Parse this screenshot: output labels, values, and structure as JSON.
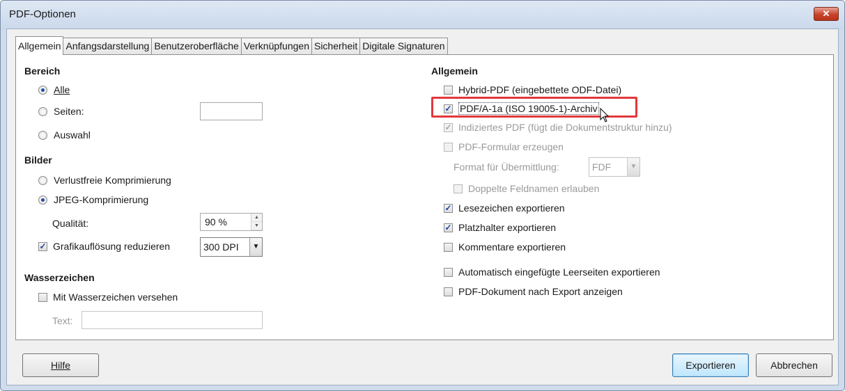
{
  "window": {
    "title": "PDF-Optionen",
    "close_glyph": "✕"
  },
  "tabs": [
    {
      "label": "Allgemein",
      "active": true
    },
    {
      "label": "Anfangsdarstellung"
    },
    {
      "label": "Benutzeroberfläche"
    },
    {
      "label": "Verknüpfungen"
    },
    {
      "label": "Sicherheit"
    },
    {
      "label": "Digitale Signaturen"
    }
  ],
  "left": {
    "bereich": {
      "heading": "Bereich",
      "alle": "Alle",
      "seiten": "Seiten:",
      "seiten_value": "",
      "auswahl": "Auswahl",
      "selected": "Alle"
    },
    "bilder": {
      "heading": "Bilder",
      "verlustfrei": "Verlustfreie Komprimierung",
      "jpeg": "JPEG-Komprimierung",
      "selected": "JPEG-Komprimierung",
      "qualitaet_label": "Qualität:",
      "qualitaet_value": "90 %",
      "reduce_label": "Grafikauflösung reduzieren",
      "reduce_checked": true,
      "dpi_value": "300 DPI"
    },
    "wasserzeichen": {
      "heading": "Wasserzeichen",
      "check_label": "Mit Wasserzeichen versehen",
      "checked": false,
      "text_label": "Text:",
      "text_value": ""
    }
  },
  "right": {
    "heading": "Allgemein",
    "hybrid": "Hybrid-PDF (eingebettete ODF-Datei)",
    "pdfa": "PDF/A-1a (ISO 19005-1)-Archiv",
    "indiziert": "Indiziertes PDF (fügt die Dokumentstruktur hinzu)",
    "formular": "PDF-Formular erzeugen",
    "format_label": "Format für Übermittlung:",
    "format_value": "FDF",
    "doppelte": "Doppelte Feldnamen erlauben",
    "lesezeichen": "Lesezeichen exportieren",
    "platzhalter": "Platzhalter exportieren",
    "kommentare": "Kommentare exportieren",
    "leerseiten": "Automatisch eingefügte Leerseiten exportieren",
    "anzeigen": "PDF-Dokument nach Export anzeigen",
    "check_glyph": "✓",
    "highlight_color": "#e2383c"
  },
  "buttons": {
    "hilfe": "Hilfe",
    "exportieren": "Exportieren",
    "abbrechen": "Abbrechen"
  }
}
